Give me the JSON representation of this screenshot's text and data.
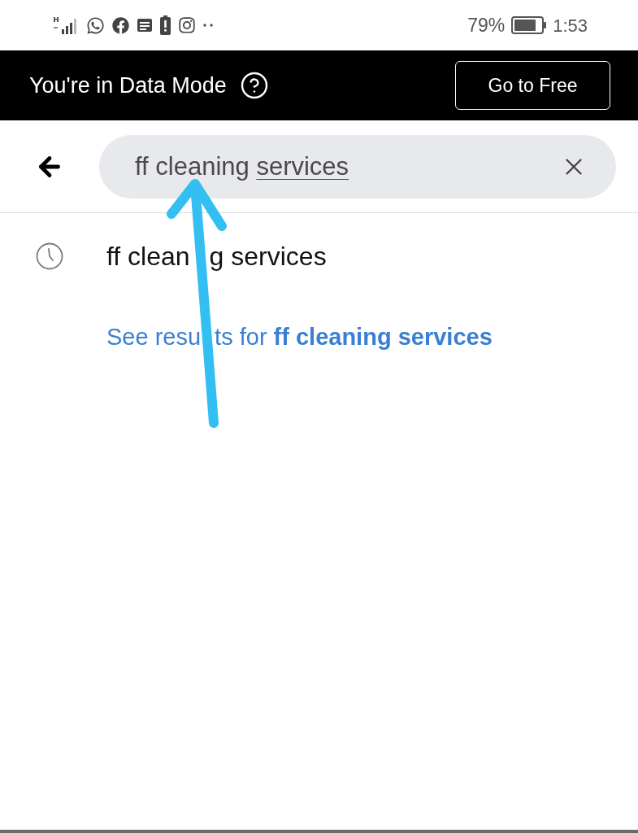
{
  "status_bar": {
    "battery_percent": "79%",
    "time": "1:53"
  },
  "banner": {
    "message": "You're in Data Mode",
    "button": "Go to Free"
  },
  "search": {
    "value": [
      {
        "text": "ff cleaning",
        "underlined": false
      },
      {
        "text": "services",
        "underlined": true
      }
    ]
  },
  "suggestions": [
    {
      "kind": "history",
      "text_parts": [
        "ff clean",
        "g services"
      ]
    }
  ],
  "see_results": {
    "text_parts": [
      "See resu",
      "ts for **ff cleaning services**"
    ]
  },
  "annotations": [
    {
      "kind": "arrow"
    }
  ]
}
